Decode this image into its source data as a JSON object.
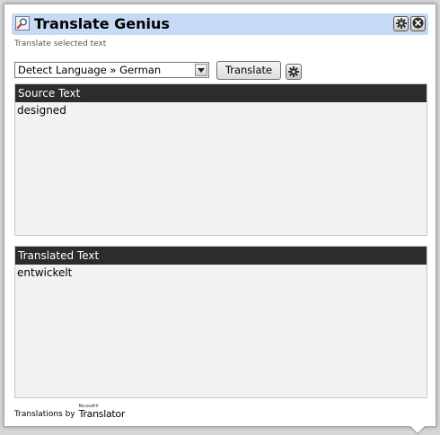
{
  "header": {
    "title": "Translate Genius",
    "subtitle": "Translate selected text",
    "buttons": [
      {
        "icon": "gear-icon"
      },
      {
        "icon": "close-icon"
      }
    ]
  },
  "controls": {
    "language_select": {
      "selected": "Detect Language » German"
    },
    "translate_label": "Translate",
    "settings_icon": "gear-icon"
  },
  "source": {
    "header": "Source Text",
    "text": "designed"
  },
  "translated": {
    "header": "Translated Text",
    "text": "entwickelt"
  },
  "footer": {
    "label": "Translations by",
    "logo_small": "Microsoft®",
    "logo_name": "Translator"
  },
  "colors": {
    "title_bar": "#c6d9f5",
    "panel_header": "#2c2c2c",
    "panel_body": "#f2f2f2"
  }
}
